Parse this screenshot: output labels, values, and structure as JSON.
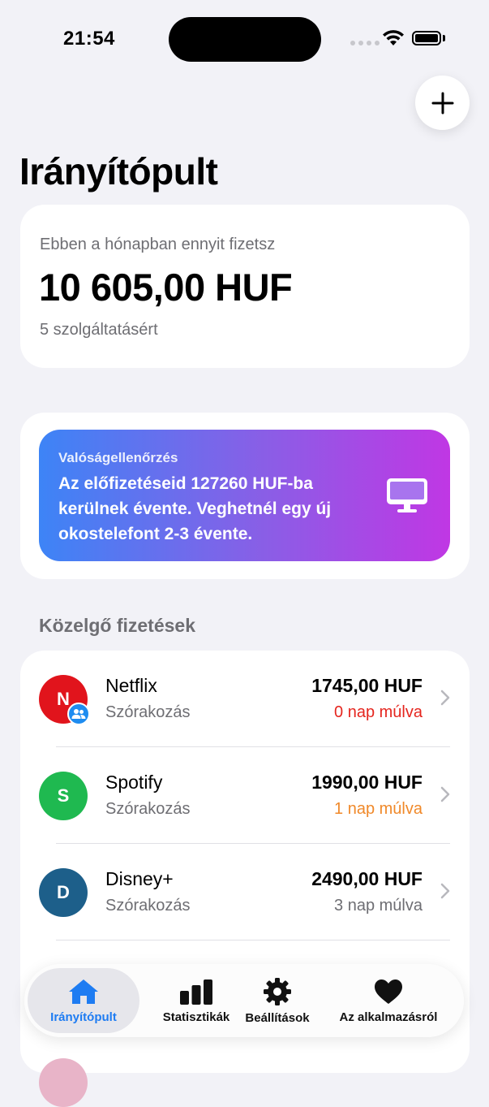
{
  "status_bar": {
    "time": "21:54"
  },
  "header": {
    "add_icon": "plus-icon"
  },
  "page": {
    "title": "Irányítópult"
  },
  "summary": {
    "label": "Ebben a hónapban ennyit fizetsz",
    "amount": "10 605,00 HUF",
    "count": "5 szolgáltatásért"
  },
  "reality_check": {
    "title": "Valóságellenőrzés",
    "text": "Az előfizetéseid 127260 HUF-ba kerülnek évente. Veghetnél egy új okostelefont 2-3 évente.",
    "icon": "monitor-icon",
    "gradient": [
      "#3d84f6",
      "#c037e4"
    ]
  },
  "upcoming": {
    "title": "Közelgő fizetések",
    "items": [
      {
        "initial": "N",
        "name": "Netflix",
        "category": "Szórakozás",
        "price": "1745,00 HUF",
        "due": "0 nap múlva",
        "due_color": "#e5261f",
        "avatar_color": "#e1141c",
        "shared": true
      },
      {
        "initial": "S",
        "name": "Spotify",
        "category": "Szórakozás",
        "price": "1990,00 HUF",
        "due": "1 nap múlva",
        "due_color": "#f0892a",
        "avatar_color": "#1fb950",
        "shared": false
      },
      {
        "initial": "D",
        "name": "Disney+",
        "category": "Szórakozás",
        "price": "2490,00 HUF",
        "due": "3 nap múlva",
        "due_color": "#6e6e73",
        "avatar_color": "#1d5f8a",
        "shared": false
      }
    ]
  },
  "tab_bar": {
    "accent": "#1e7cf2",
    "tabs": [
      {
        "label": "Irányítópult",
        "icon": "house-icon",
        "active": true
      },
      {
        "label": "Statisztikák",
        "icon": "bar-chart-icon",
        "active": false
      },
      {
        "label": "Beállítások",
        "icon": "gear-icon",
        "active": false
      },
      {
        "label": "Az alkalmazásról",
        "icon": "heart-icon",
        "active": false
      }
    ]
  }
}
